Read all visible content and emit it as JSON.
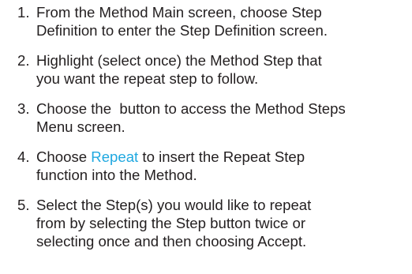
{
  "steps": [
    {
      "number": "1.",
      "lines": [
        "From the Method Main screen, choose Step",
        "Definition to enter the Step Definition screen."
      ]
    },
    {
      "number": "2.",
      "lines": [
        "Highlight (select once) the Method Step that",
        "you want the repeat step to follow."
      ]
    },
    {
      "number": "3.",
      "lines": [
        "Choose the  button to access the Method Steps",
        "Menu screen."
      ]
    },
    {
      "number": "4.",
      "before": "Choose ",
      "link": "Repeat",
      "after": " to insert the Repeat Step",
      "line2": "function into the Method.",
      "link_color": "#1fa8e0"
    },
    {
      "number": "5.",
      "lines": [
        "Select the Step(s) you would like to repeat",
        "from by selecting the Step button twice or",
        "selecting once and then choosing Accept."
      ]
    }
  ]
}
